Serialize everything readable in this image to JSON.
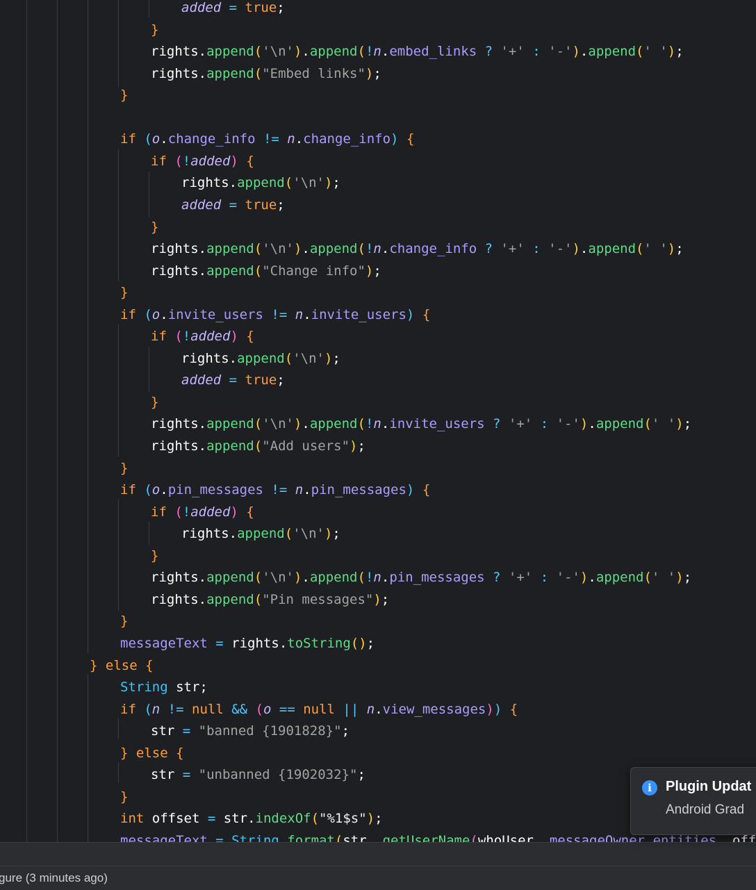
{
  "editor": {
    "lines": [
      [
        [
          "lv",
          "added"
        ],
        [
          "op",
          " = "
        ],
        [
          "kw",
          "true"
        ],
        [
          "tail",
          ";"
        ]
      ],
      [
        [
          "pn",
          "}"
        ]
      ],
      [
        [
          "id",
          "rights"
        ],
        [
          "tail",
          "."
        ],
        [
          "mt",
          "append"
        ],
        [
          "p1",
          "("
        ],
        [
          "str",
          "'\\n'"
        ],
        [
          "p1",
          ")"
        ],
        [
          "tail",
          "."
        ],
        [
          "mt",
          "append"
        ],
        [
          "p1",
          "("
        ],
        [
          "op",
          "!"
        ],
        [
          "lv",
          "n"
        ],
        [
          "tail",
          "."
        ],
        [
          "fd",
          "embed_links"
        ],
        [
          "op",
          " ? "
        ],
        [
          "str",
          "'+'"
        ],
        [
          "op",
          " : "
        ],
        [
          "str",
          "'-'"
        ],
        [
          "p1",
          ")"
        ],
        [
          "tail",
          "."
        ],
        [
          "mt",
          "append"
        ],
        [
          "p1",
          "("
        ],
        [
          "str",
          "' '"
        ],
        [
          "p1",
          ")"
        ],
        [
          "tail",
          ";"
        ]
      ],
      [
        [
          "id",
          "rights"
        ],
        [
          "tail",
          "."
        ],
        [
          "mt",
          "append"
        ],
        [
          "p1",
          "("
        ],
        [
          "str",
          "\"Embed links\""
        ],
        [
          "p1",
          ")"
        ],
        [
          "tail",
          ";"
        ]
      ],
      [
        [
          "pn",
          "}"
        ]
      ],
      [],
      [
        [
          "kw",
          "if "
        ],
        [
          "p3",
          "("
        ],
        [
          "lv",
          "o"
        ],
        [
          "tail",
          "."
        ],
        [
          "fd",
          "change_info"
        ],
        [
          "op",
          " != "
        ],
        [
          "lv",
          "n"
        ],
        [
          "tail",
          "."
        ],
        [
          "fd",
          "change_info"
        ],
        [
          "p3",
          ")"
        ],
        [
          "pn",
          " {"
        ]
      ],
      [
        [
          "kw",
          "if "
        ],
        [
          "p2",
          "("
        ],
        [
          "op",
          "!"
        ],
        [
          "lv",
          "added"
        ],
        [
          "p2",
          ")"
        ],
        [
          "pn",
          " {"
        ]
      ],
      [
        [
          "id",
          "rights"
        ],
        [
          "tail",
          "."
        ],
        [
          "mt",
          "append"
        ],
        [
          "p1",
          "("
        ],
        [
          "str",
          "'\\n'"
        ],
        [
          "p1",
          ")"
        ],
        [
          "tail",
          ";"
        ]
      ],
      [
        [
          "lv",
          "added"
        ],
        [
          "op",
          " = "
        ],
        [
          "kw",
          "true"
        ],
        [
          "tail",
          ";"
        ]
      ],
      [
        [
          "pn",
          "}"
        ]
      ],
      [
        [
          "id",
          "rights"
        ],
        [
          "tail",
          "."
        ],
        [
          "mt",
          "append"
        ],
        [
          "p1",
          "("
        ],
        [
          "str",
          "'\\n'"
        ],
        [
          "p1",
          ")"
        ],
        [
          "tail",
          "."
        ],
        [
          "mt",
          "append"
        ],
        [
          "p1",
          "("
        ],
        [
          "op",
          "!"
        ],
        [
          "lv",
          "n"
        ],
        [
          "tail",
          "."
        ],
        [
          "fd",
          "change_info"
        ],
        [
          "op",
          " ? "
        ],
        [
          "str",
          "'+'"
        ],
        [
          "op",
          " : "
        ],
        [
          "str",
          "'-'"
        ],
        [
          "p1",
          ")"
        ],
        [
          "tail",
          "."
        ],
        [
          "mt",
          "append"
        ],
        [
          "p1",
          "("
        ],
        [
          "str",
          "' '"
        ],
        [
          "p1",
          ")"
        ],
        [
          "tail",
          ";"
        ]
      ],
      [
        [
          "id",
          "rights"
        ],
        [
          "tail",
          "."
        ],
        [
          "mt",
          "append"
        ],
        [
          "p1",
          "("
        ],
        [
          "str",
          "\"Change info\""
        ],
        [
          "p1",
          ")"
        ],
        [
          "tail",
          ";"
        ]
      ],
      [
        [
          "pn",
          "}"
        ]
      ],
      [
        [
          "kw",
          "if "
        ],
        [
          "p3",
          "("
        ],
        [
          "lv",
          "o"
        ],
        [
          "tail",
          "."
        ],
        [
          "fd",
          "invite_users"
        ],
        [
          "op",
          " != "
        ],
        [
          "lv",
          "n"
        ],
        [
          "tail",
          "."
        ],
        [
          "fd",
          "invite_users"
        ],
        [
          "p3",
          ")"
        ],
        [
          "pn",
          " {"
        ]
      ],
      [
        [
          "kw",
          "if "
        ],
        [
          "p2",
          "("
        ],
        [
          "op",
          "!"
        ],
        [
          "lv",
          "added"
        ],
        [
          "p2",
          ")"
        ],
        [
          "pn",
          " {"
        ]
      ],
      [
        [
          "id",
          "rights"
        ],
        [
          "tail",
          "."
        ],
        [
          "mt",
          "append"
        ],
        [
          "p1",
          "("
        ],
        [
          "str",
          "'\\n'"
        ],
        [
          "p1",
          ")"
        ],
        [
          "tail",
          ";"
        ]
      ],
      [
        [
          "lv",
          "added"
        ],
        [
          "op",
          " = "
        ],
        [
          "kw",
          "true"
        ],
        [
          "tail",
          ";"
        ]
      ],
      [
        [
          "pn",
          "}"
        ]
      ],
      [
        [
          "id",
          "rights"
        ],
        [
          "tail",
          "."
        ],
        [
          "mt",
          "append"
        ],
        [
          "p1",
          "("
        ],
        [
          "str",
          "'\\n'"
        ],
        [
          "p1",
          ")"
        ],
        [
          "tail",
          "."
        ],
        [
          "mt",
          "append"
        ],
        [
          "p1",
          "("
        ],
        [
          "op",
          "!"
        ],
        [
          "lv",
          "n"
        ],
        [
          "tail",
          "."
        ],
        [
          "fd",
          "invite_users"
        ],
        [
          "op",
          " ? "
        ],
        [
          "str",
          "'+'"
        ],
        [
          "op",
          " : "
        ],
        [
          "str",
          "'-'"
        ],
        [
          "p1",
          ")"
        ],
        [
          "tail",
          "."
        ],
        [
          "mt",
          "append"
        ],
        [
          "p1",
          "("
        ],
        [
          "str",
          "' '"
        ],
        [
          "p1",
          ")"
        ],
        [
          "tail",
          ";"
        ]
      ],
      [
        [
          "id",
          "rights"
        ],
        [
          "tail",
          "."
        ],
        [
          "mt",
          "append"
        ],
        [
          "p1",
          "("
        ],
        [
          "str",
          "\"Add users\""
        ],
        [
          "p1",
          ")"
        ],
        [
          "tail",
          ";"
        ]
      ],
      [
        [
          "pn",
          "}"
        ]
      ],
      [
        [
          "kw",
          "if "
        ],
        [
          "p3",
          "("
        ],
        [
          "lv",
          "o"
        ],
        [
          "tail",
          "."
        ],
        [
          "fd",
          "pin_messages"
        ],
        [
          "op",
          " != "
        ],
        [
          "lv",
          "n"
        ],
        [
          "tail",
          "."
        ],
        [
          "fd",
          "pin_messages"
        ],
        [
          "p3",
          ")"
        ],
        [
          "pn",
          " {"
        ]
      ],
      [
        [
          "kw",
          "if "
        ],
        [
          "p2",
          "("
        ],
        [
          "op",
          "!"
        ],
        [
          "lv",
          "added"
        ],
        [
          "p2",
          ")"
        ],
        [
          "pn",
          " {"
        ]
      ],
      [
        [
          "id",
          "rights"
        ],
        [
          "tail",
          "."
        ],
        [
          "mt",
          "append"
        ],
        [
          "p1",
          "("
        ],
        [
          "str",
          "'\\n'"
        ],
        [
          "p1",
          ")"
        ],
        [
          "tail",
          ";"
        ]
      ],
      [
        [
          "pn",
          "}"
        ]
      ],
      [
        [
          "id",
          "rights"
        ],
        [
          "tail",
          "."
        ],
        [
          "mt",
          "append"
        ],
        [
          "p1",
          "("
        ],
        [
          "str",
          "'\\n'"
        ],
        [
          "p1",
          ")"
        ],
        [
          "tail",
          "."
        ],
        [
          "mt",
          "append"
        ],
        [
          "p1",
          "("
        ],
        [
          "op",
          "!"
        ],
        [
          "lv",
          "n"
        ],
        [
          "tail",
          "."
        ],
        [
          "fd",
          "pin_messages"
        ],
        [
          "op",
          " ? "
        ],
        [
          "str",
          "'+'"
        ],
        [
          "op",
          " : "
        ],
        [
          "str",
          "'-'"
        ],
        [
          "p1",
          ")"
        ],
        [
          "tail",
          "."
        ],
        [
          "mt",
          "append"
        ],
        [
          "p1",
          "("
        ],
        [
          "str",
          "' '"
        ],
        [
          "p1",
          ")"
        ],
        [
          "tail",
          ";"
        ]
      ],
      [
        [
          "id",
          "rights"
        ],
        [
          "tail",
          "."
        ],
        [
          "mt",
          "append"
        ],
        [
          "p1",
          "("
        ],
        [
          "str",
          "\"Pin messages\""
        ],
        [
          "p1",
          ")"
        ],
        [
          "tail",
          ";"
        ]
      ],
      [
        [
          "pn",
          "}"
        ]
      ],
      [
        [
          "fd",
          "messageText"
        ],
        [
          "op",
          " = "
        ],
        [
          "id",
          "rights"
        ],
        [
          "tail",
          "."
        ],
        [
          "mt",
          "toString"
        ],
        [
          "p1",
          "()"
        ],
        [
          "tail",
          ";"
        ]
      ],
      [
        [
          "pn",
          "}"
        ],
        [
          "kw",
          " else "
        ],
        [
          "pn",
          "{"
        ]
      ],
      [
        [
          "ty",
          "String"
        ],
        [
          "id",
          " str"
        ],
        [
          "tail",
          ";"
        ]
      ],
      [
        [
          "kw",
          "if "
        ],
        [
          "p3",
          "("
        ],
        [
          "lv",
          "n"
        ],
        [
          "op",
          " != "
        ],
        [
          "kw",
          "null"
        ],
        [
          "op",
          " && "
        ],
        [
          "p2",
          "("
        ],
        [
          "lv",
          "o"
        ],
        [
          "op",
          " == "
        ],
        [
          "kw",
          "null"
        ],
        [
          "op",
          " || "
        ],
        [
          "lv",
          "n"
        ],
        [
          "tail",
          "."
        ],
        [
          "fd",
          "view_messages"
        ],
        [
          "p2",
          ")"
        ],
        [
          "p3",
          ")"
        ],
        [
          "pn",
          " {"
        ]
      ],
      [
        [
          "id",
          "str"
        ],
        [
          "op",
          " = "
        ],
        [
          "str",
          "\"banned {1901828}\""
        ],
        [
          "tail",
          ";"
        ]
      ],
      [
        [
          "pn",
          "}"
        ],
        [
          "kw",
          " else "
        ],
        [
          "pn",
          "{"
        ]
      ],
      [
        [
          "id",
          "str"
        ],
        [
          "op",
          " = "
        ],
        [
          "str",
          "\"unbanned {1902032}\""
        ],
        [
          "tail",
          ";"
        ]
      ],
      [
        [
          "pn",
          "}"
        ]
      ],
      [
        [
          "kw",
          "int"
        ],
        [
          "id",
          " offset"
        ],
        [
          "op",
          " = "
        ],
        [
          "id",
          "str"
        ],
        [
          "tail",
          "."
        ],
        [
          "mt",
          "indexOf"
        ],
        [
          "p1",
          "("
        ],
        [
          "num",
          "\"%1$s\""
        ],
        [
          "p1",
          ")"
        ],
        [
          "tail",
          ";"
        ]
      ],
      [
        [
          "fd",
          "messageText"
        ],
        [
          "op",
          " = "
        ],
        [
          "ty",
          "String"
        ],
        [
          "tail",
          "."
        ],
        [
          "mt",
          "format"
        ],
        [
          "p1",
          "("
        ],
        [
          "id",
          "str"
        ],
        [
          "tail",
          ", "
        ],
        [
          "mt",
          "getUserName"
        ],
        [
          "p2",
          "("
        ],
        [
          "id",
          "whoUser"
        ],
        [
          "tail",
          ", "
        ],
        [
          "fd",
          "messageOwner"
        ],
        [
          "tail",
          "."
        ],
        [
          "fd",
          "entities"
        ],
        [
          "tail",
          ", "
        ],
        [
          "id",
          "offset"
        ]
      ]
    ]
  },
  "notification": {
    "icon": "info-icon",
    "title": "Plugin Updat",
    "body": "Android Grad"
  },
  "statusbar": {
    "text": "gure (3 minutes ago)"
  }
}
